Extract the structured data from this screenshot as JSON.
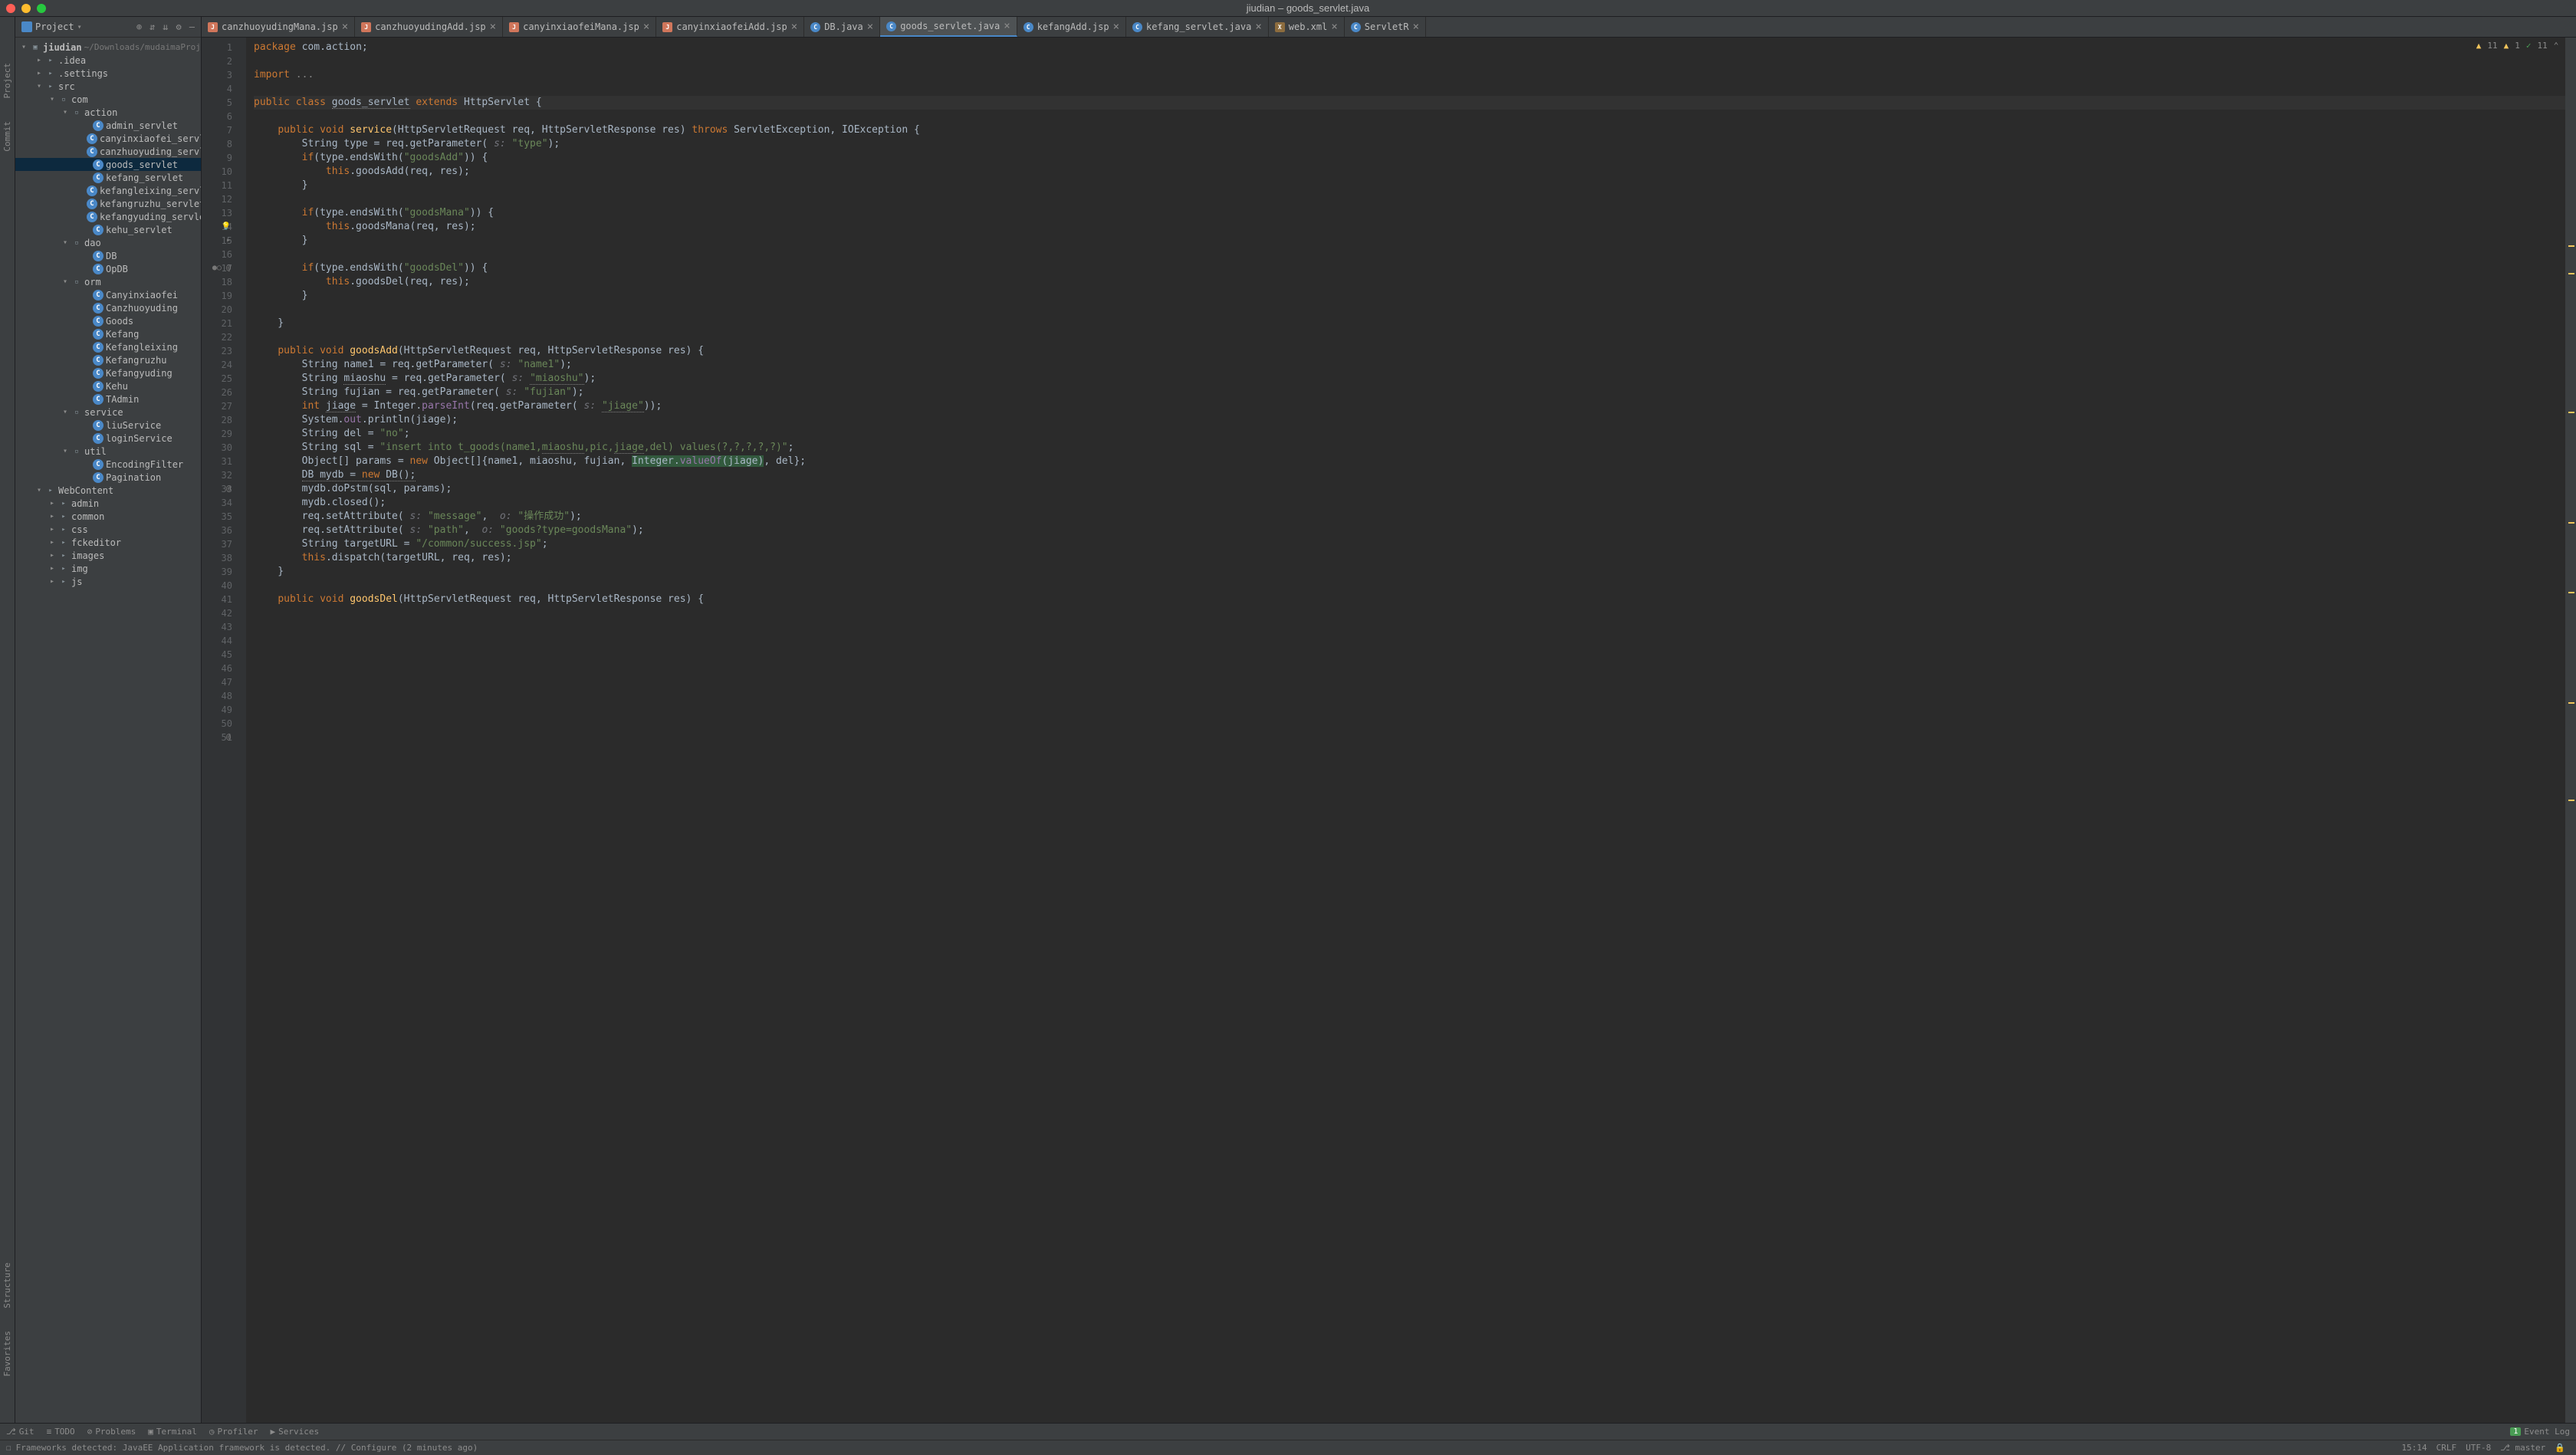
{
  "title": "jiudian – goods_servlet.java",
  "sidebar": {
    "title": "Project",
    "root_name": "jiudian",
    "root_hint": "~/Downloads/mudaimaProj",
    "items": [
      {
        "indent": 28,
        "arrow": "▸",
        "icon": "folder",
        "label": ".idea"
      },
      {
        "indent": 28,
        "arrow": "▸",
        "icon": "folder",
        "label": ".settings"
      },
      {
        "indent": 28,
        "arrow": "▾",
        "icon": "folder-module",
        "label": "src"
      },
      {
        "indent": 45,
        "arrow": "▾",
        "icon": "pkg",
        "label": "com"
      },
      {
        "indent": 62,
        "arrow": "▾",
        "icon": "pkg",
        "label": "action"
      },
      {
        "indent": 90,
        "arrow": "",
        "icon": "class",
        "label": "admin_servlet"
      },
      {
        "indent": 90,
        "arrow": "",
        "icon": "class",
        "label": "canyinxiaofei_servlet"
      },
      {
        "indent": 90,
        "arrow": "",
        "icon": "class",
        "label": "canzhuoyuding_servlet"
      },
      {
        "indent": 90,
        "arrow": "",
        "icon": "class",
        "label": "goods_servlet",
        "selected": true
      },
      {
        "indent": 90,
        "arrow": "",
        "icon": "class",
        "label": "kefang_servlet"
      },
      {
        "indent": 90,
        "arrow": "",
        "icon": "class",
        "label": "kefangleixing_servlet"
      },
      {
        "indent": 90,
        "arrow": "",
        "icon": "class",
        "label": "kefangruzhu_servlet"
      },
      {
        "indent": 90,
        "arrow": "",
        "icon": "class",
        "label": "kefangyuding_servlet"
      },
      {
        "indent": 90,
        "arrow": "",
        "icon": "class",
        "label": "kehu_servlet"
      },
      {
        "indent": 62,
        "arrow": "▾",
        "icon": "pkg",
        "label": "dao"
      },
      {
        "indent": 90,
        "arrow": "",
        "icon": "class",
        "label": "DB"
      },
      {
        "indent": 90,
        "arrow": "",
        "icon": "class",
        "label": "OpDB"
      },
      {
        "indent": 62,
        "arrow": "▾",
        "icon": "pkg",
        "label": "orm"
      },
      {
        "indent": 90,
        "arrow": "",
        "icon": "class",
        "label": "Canyinxiaofei"
      },
      {
        "indent": 90,
        "arrow": "",
        "icon": "class",
        "label": "Canzhuoyuding"
      },
      {
        "indent": 90,
        "arrow": "",
        "icon": "class",
        "label": "Goods"
      },
      {
        "indent": 90,
        "arrow": "",
        "icon": "class",
        "label": "Kefang"
      },
      {
        "indent": 90,
        "arrow": "",
        "icon": "class",
        "label": "Kefangleixing"
      },
      {
        "indent": 90,
        "arrow": "",
        "icon": "class",
        "label": "Kefangruzhu"
      },
      {
        "indent": 90,
        "arrow": "",
        "icon": "class",
        "label": "Kefangyuding"
      },
      {
        "indent": 90,
        "arrow": "",
        "icon": "class",
        "label": "Kehu"
      },
      {
        "indent": 90,
        "arrow": "",
        "icon": "class",
        "label": "TAdmin"
      },
      {
        "indent": 62,
        "arrow": "▾",
        "icon": "pkg",
        "label": "service"
      },
      {
        "indent": 90,
        "arrow": "",
        "icon": "class",
        "label": "liuService"
      },
      {
        "indent": 90,
        "arrow": "",
        "icon": "class",
        "label": "loginService"
      },
      {
        "indent": 62,
        "arrow": "▾",
        "icon": "pkg",
        "label": "util"
      },
      {
        "indent": 90,
        "arrow": "",
        "icon": "class",
        "label": "EncodingFilter"
      },
      {
        "indent": 90,
        "arrow": "",
        "icon": "class",
        "label": "Pagination"
      },
      {
        "indent": 28,
        "arrow": "▾",
        "icon": "folder",
        "label": "WebContent"
      },
      {
        "indent": 45,
        "arrow": "▸",
        "icon": "folder",
        "label": "admin"
      },
      {
        "indent": 45,
        "arrow": "▸",
        "icon": "folder",
        "label": "common"
      },
      {
        "indent": 45,
        "arrow": "▸",
        "icon": "folder",
        "label": "css"
      },
      {
        "indent": 45,
        "arrow": "▸",
        "icon": "folder",
        "label": "fckeditor"
      },
      {
        "indent": 45,
        "arrow": "▸",
        "icon": "folder",
        "label": "images"
      },
      {
        "indent": 45,
        "arrow": "▸",
        "icon": "folder",
        "label": "img"
      },
      {
        "indent": 45,
        "arrow": "▸",
        "icon": "folder",
        "label": "js"
      }
    ]
  },
  "tabs": [
    {
      "icon": "jsp",
      "label": "canzhuoyudingMana.jsp"
    },
    {
      "icon": "jsp",
      "label": "canzhuoyudingAdd.jsp"
    },
    {
      "icon": "jsp",
      "label": "canyinxiaofeiMana.jsp"
    },
    {
      "icon": "jsp",
      "label": "canyinxiaofeiAdd.jsp"
    },
    {
      "icon": "java",
      "label": "DB.java"
    },
    {
      "icon": "java",
      "label": "goods_servlet.java",
      "active": true
    },
    {
      "icon": "java",
      "label": "kefangAdd.jsp"
    },
    {
      "icon": "java",
      "label": "kefang_servlet.java"
    },
    {
      "icon": "xml",
      "label": "web.xml"
    },
    {
      "icon": "java",
      "label": "ServletR"
    }
  ],
  "gutter_start": 1,
  "gutter_end": 51,
  "warnings": {
    "w1": "11",
    "w2": "1",
    "chk": "11"
  },
  "bottom": {
    "git": "Git",
    "todo": "TODO",
    "problems": "Problems",
    "terminal": "Terminal",
    "profiler": "Profiler",
    "services": "Services",
    "eventlog": "Event Log"
  },
  "status": {
    "msg": "Frameworks detected: JavaEE Application framework is detected. // Configure (2 minutes ago)",
    "cursor": "15:14",
    "crlf": "CRLF",
    "enc": "UTF-8",
    "branch": "master"
  },
  "left_gutter": {
    "project": "Project",
    "commit": "Commit",
    "structure": "Structure",
    "favorites": "Favorites"
  }
}
